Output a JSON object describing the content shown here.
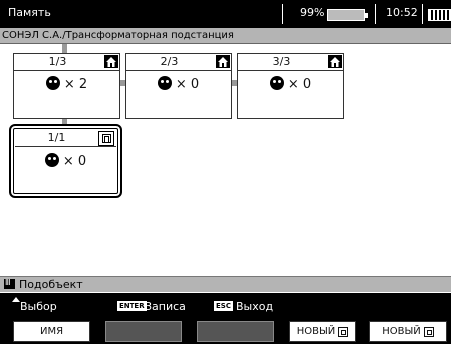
{
  "header": {
    "title": "Память",
    "battery": "99%",
    "clock": "10:52"
  },
  "path": "СОНЭЛ С.А./Трансформаторная подстанция",
  "nodes": [
    {
      "label": "1/3",
      "count": "× 2",
      "mark": "house-icon"
    },
    {
      "label": "2/3",
      "count": "× 0",
      "mark": "house-icon"
    },
    {
      "label": "3/3",
      "count": "× 0",
      "mark": "house-icon"
    },
    {
      "label": "1/1",
      "count": "× 0",
      "mark": "subobject-icon"
    }
  ],
  "status": {
    "text": "Подобъект"
  },
  "hints": {
    "select": "Выбор",
    "enter_key": "ENTER",
    "enter_label": "Записа",
    "esc_key": "ESC",
    "esc_label": "Выход"
  },
  "fbuttons": {
    "name": "ИМЯ",
    "new1": "НОВЫЙ",
    "new2": "НОВЫЙ"
  }
}
